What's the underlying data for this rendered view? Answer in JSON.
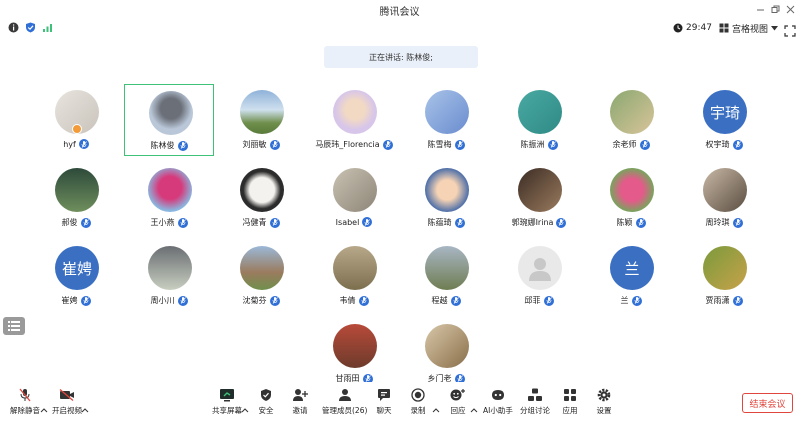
{
  "window": {
    "title": "腾讯会议"
  },
  "status": {
    "timer": "29:47",
    "view_label": "宫格视图"
  },
  "speaking": {
    "text": "正在讲话: 陈林俊;"
  },
  "participants": [
    {
      "name": "hyf"
    },
    {
      "name": "陈林俊"
    },
    {
      "name": "刘丽敏"
    },
    {
      "name": "马辰玮_Florencia"
    },
    {
      "name": "陈雪梅"
    },
    {
      "name": "陈振洲"
    },
    {
      "name": "余老师"
    },
    {
      "name": "权宇琦",
      "initials": "宇琦"
    },
    {
      "name": "郝俊"
    },
    {
      "name": "王小燕"
    },
    {
      "name": "冯健青"
    },
    {
      "name": "Isabel"
    },
    {
      "name": "陈蕴琦"
    },
    {
      "name": "郭琬娜Irina"
    },
    {
      "name": "陈颖"
    },
    {
      "name": "周玲琪"
    },
    {
      "name": "崔娉",
      "initials": "崔娉"
    },
    {
      "name": "周小川"
    },
    {
      "name": "沈菊芬"
    },
    {
      "name": "韦倩"
    },
    {
      "name": "程越"
    },
    {
      "name": "邱菲"
    },
    {
      "name": "兰",
      "initials": "兰"
    },
    {
      "name": "贾雨潇"
    },
    {
      "name": "甘雨田"
    },
    {
      "name": "乡门老"
    }
  ],
  "toolbar": {
    "unmute": "解除静音",
    "start_video": "开启视频",
    "share_screen": "共享屏幕",
    "security": "安全",
    "invite": "邀请",
    "members": "管理成员(26)",
    "chat": "聊天",
    "record": "录制",
    "reaction": "回应",
    "ai_assistant": "AI小助手",
    "breakout": "分组讨论",
    "apps": "应用",
    "settings": "设置",
    "end_meeting": "结束会议"
  },
  "colors": {
    "accent": "#2f6fd6",
    "active_border": "#3ec27a",
    "end_red": "#e0463d",
    "banner_bg": "#eaf0f9"
  }
}
